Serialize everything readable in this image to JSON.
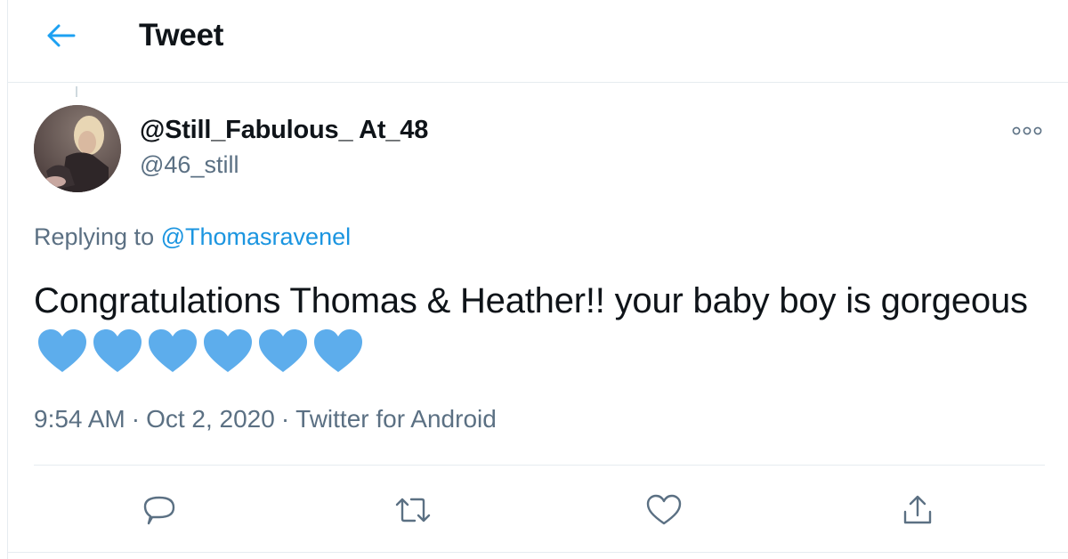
{
  "header": {
    "title": "Tweet",
    "back_icon": "arrow-left-icon"
  },
  "tweet": {
    "display_name": "@Still_Fabulous_ At_48",
    "handle": "@46_still",
    "replying_prefix": "Replying to",
    "replying_mention": "@Thomasravenel",
    "text": "Congratulations Thomas & Heather!! your baby boy is gorgeous",
    "emoji": [
      "blue-heart",
      "blue-heart",
      "blue-heart",
      "blue-heart",
      "blue-heart",
      "blue-heart"
    ],
    "time": "9:54 AM",
    "date": "Oct 2, 2020",
    "source": "Twitter for Android",
    "separator": "·"
  },
  "actions": [
    "reply-icon",
    "retweet-icon",
    "like-icon",
    "share-icon"
  ],
  "colors": {
    "accent": "#1da1f2",
    "link": "#1b95e0",
    "muted": "#5b7083",
    "border": "#e6ecf0",
    "heart": "#5dadec"
  }
}
